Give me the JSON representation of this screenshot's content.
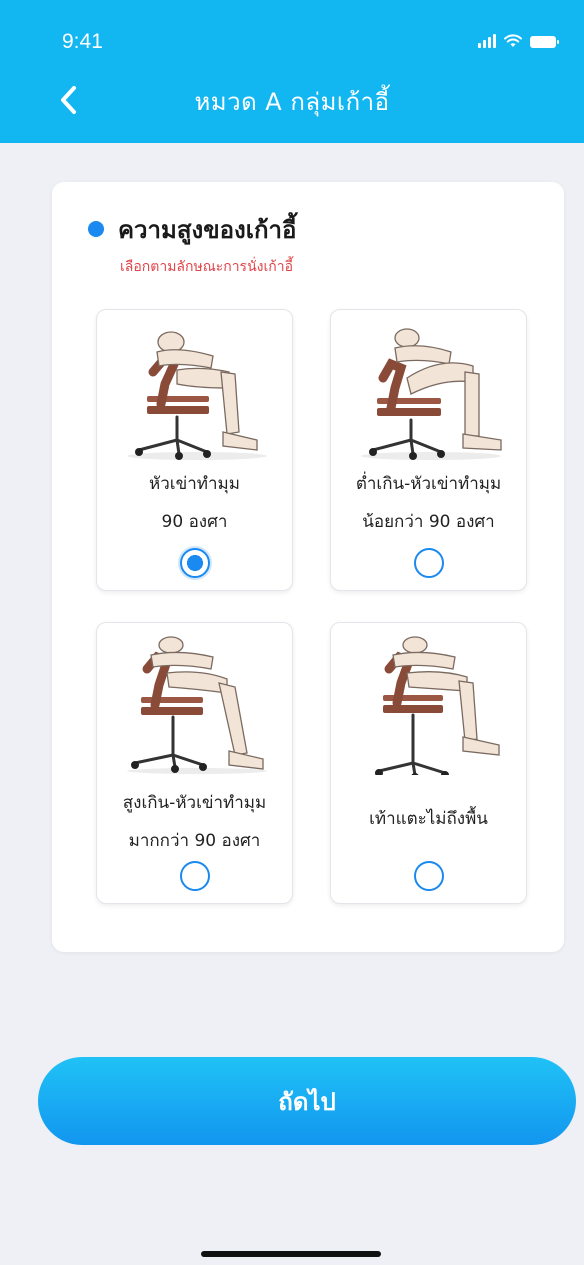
{
  "status_bar": {
    "time": "9:41"
  },
  "header": {
    "title": "หมวด A กลุ่มเก้าอี้",
    "back_icon": "chevron-left-icon"
  },
  "section": {
    "title": "ความสูงของเก้าอี้",
    "subtitle": "เลือกตามลักษณะการนั่งเก้าอี้"
  },
  "options": [
    {
      "line1": "หัวเข่าทำมุม",
      "line2": "90 องศา",
      "selected": true
    },
    {
      "line1": "ต่ำเกิน-หัวเข่าทำมุม",
      "line2": "น้อยกว่า 90 องศา",
      "selected": false
    },
    {
      "line1": "สูงเกิน-หัวเข่าทำมุม",
      "line2": "มากกว่า 90 องศา",
      "selected": false
    },
    {
      "line1": "เท้าแตะไม่ถึงพื้น",
      "selected": false
    }
  ],
  "next_button": {
    "label": "ถัดไป"
  },
  "colors": {
    "header": "#12b7f2",
    "accent": "#1a8af0",
    "subtitle": "#e0454a"
  }
}
